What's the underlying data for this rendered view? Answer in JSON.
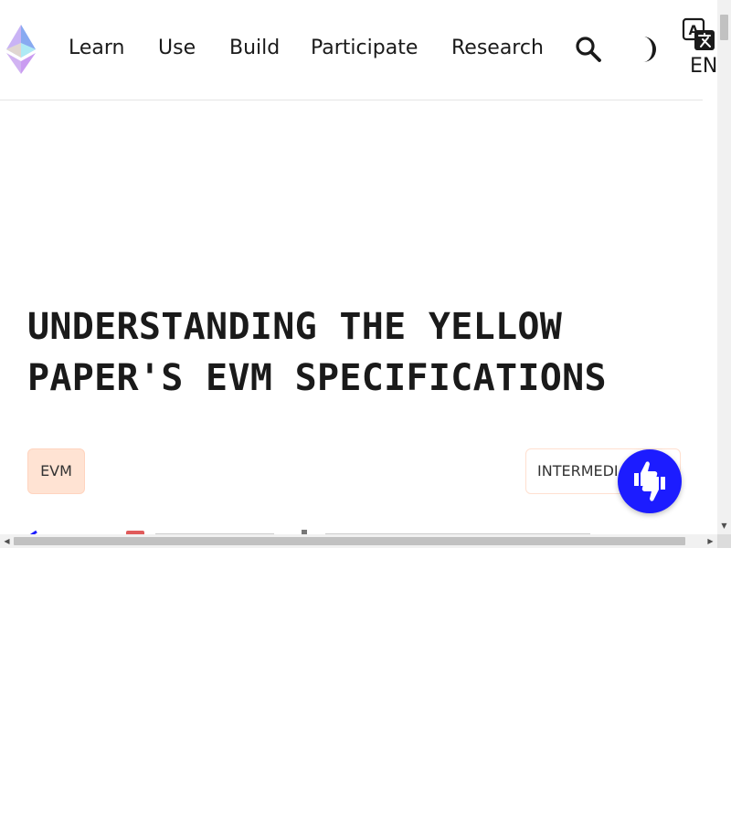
{
  "nav": {
    "links": [
      "Learn",
      "Use",
      "Build",
      "Participate",
      "Research"
    ],
    "language": "EN"
  },
  "article": {
    "title": "UNDERSTANDING THE YELLOW PAPER'S EVM SPECIFICATIONS",
    "tags": {
      "topic": "EVM",
      "level": "INTERMEDIATE"
    }
  },
  "colors": {
    "accent": "#1c1cff",
    "tag_bg": "#ffe3d3",
    "text": "#1a1a1a"
  },
  "icons": {
    "logo": "ethereum-logo",
    "search": "search-icon",
    "theme": "half-moon-icon",
    "language": "translate-icon",
    "feedback": "thumbs-up-down-icon"
  }
}
